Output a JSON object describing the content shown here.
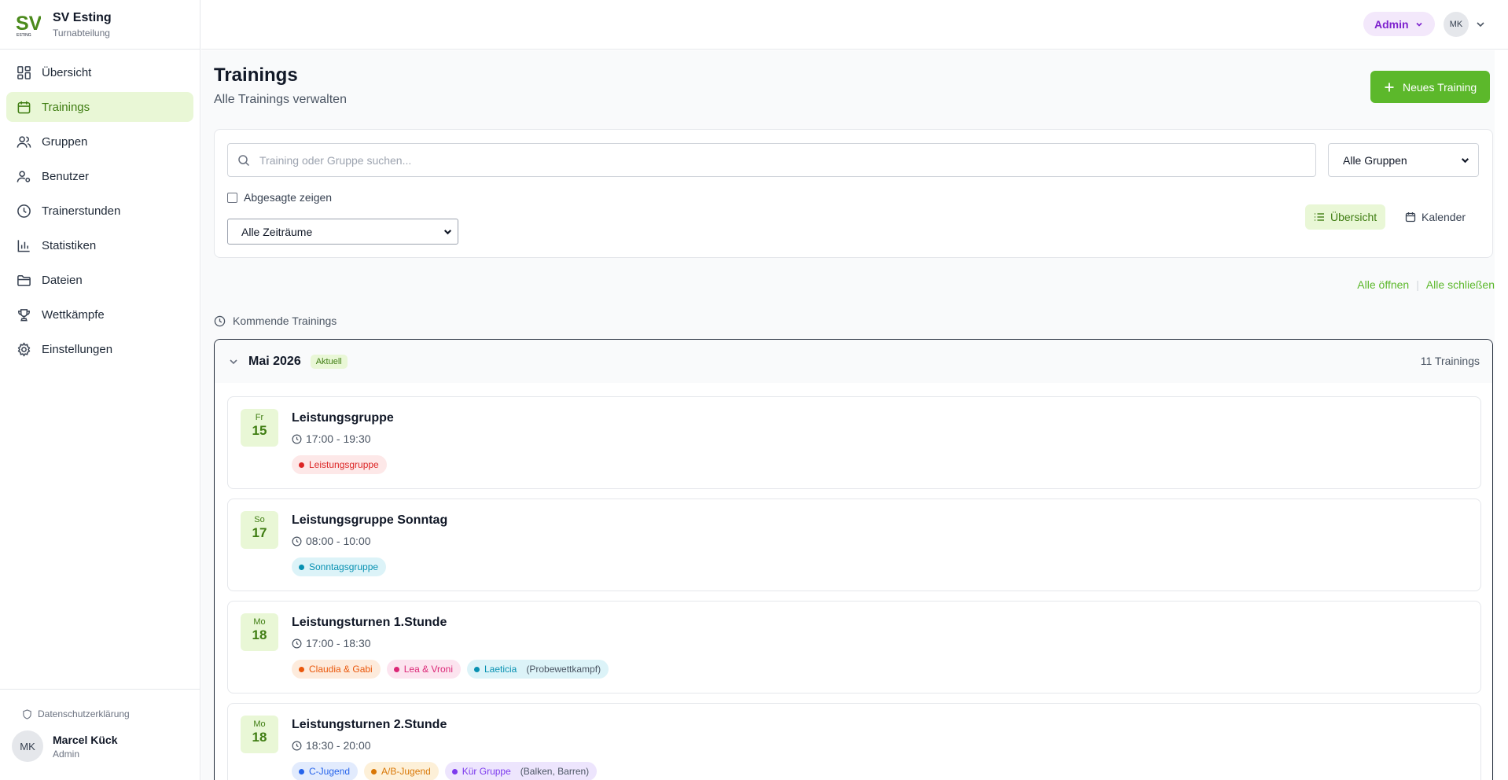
{
  "brand": {
    "logo_text": "SV",
    "logo_sub": "ESTING",
    "name": "SV Esting",
    "sub": "Turnabteilung"
  },
  "nav": [
    {
      "label": "Übersicht",
      "icon": "dashboard-icon"
    },
    {
      "label": "Trainings",
      "icon": "calendar-icon",
      "active": true
    },
    {
      "label": "Gruppen",
      "icon": "users-icon"
    },
    {
      "label": "Benutzer",
      "icon": "user-settings-icon"
    },
    {
      "label": "Trainerstunden",
      "icon": "clock-icon"
    },
    {
      "label": "Statistiken",
      "icon": "bar-chart-icon"
    },
    {
      "label": "Dateien",
      "icon": "folder-icon"
    },
    {
      "label": "Wettkämpfe",
      "icon": "trophy-icon"
    },
    {
      "label": "Einstellungen",
      "icon": "gear-icon"
    }
  ],
  "footer": {
    "privacy": "Datenschutzerklärung",
    "user_initials": "MK",
    "user_name": "Marcel Kück",
    "user_role": "Admin"
  },
  "topbar": {
    "role_label": "Admin",
    "avatar_initials": "MK"
  },
  "page": {
    "title": "Trainings",
    "subtitle": "Alle Trainings verwalten",
    "new_button": "Neues Training"
  },
  "filters": {
    "search_placeholder": "Training oder Gruppe suchen...",
    "group_select": "Alle Gruppen",
    "show_cancelled": "Abgesagte zeigen",
    "range_select": "Alle Zeiträume",
    "view_list": "Übersicht",
    "view_calendar": "Kalender"
  },
  "expand": {
    "open_all": "Alle öffnen",
    "close_all": "Alle schließen"
  },
  "upcoming_label": "Kommende Trainings",
  "month": {
    "name": "Mai 2026",
    "badge": "Aktuell",
    "count": "11 Trainings"
  },
  "trainings": [
    {
      "weekday": "Fr",
      "day": "15",
      "title": "Leistungsgruppe",
      "time": "17:00 - 19:30",
      "tags": [
        {
          "label": "Leistungsgruppe",
          "color": "#dc2626",
          "bg": "#fde8e8"
        }
      ]
    },
    {
      "weekday": "So",
      "day": "17",
      "title": "Leistungsgruppe Sonntag",
      "time": "08:00 - 10:00",
      "tags": [
        {
          "label": "Sonntagsgruppe",
          "color": "#0891b2",
          "bg": "#dcf3f8"
        }
      ]
    },
    {
      "weekday": "Mo",
      "day": "18",
      "title": "Leistungsturnen 1.Stunde",
      "time": "17:00 - 18:30",
      "tags": [
        {
          "label": "Claudia & Gabi",
          "color": "#ea580c",
          "bg": "#fdebdc"
        },
        {
          "label": "Lea & Vroni",
          "color": "#db2777",
          "bg": "#fce4ef"
        },
        {
          "label": "Laeticia",
          "note": "(Probewettkampf)",
          "color": "#0891b2",
          "bg": "#dcf3f8"
        }
      ]
    },
    {
      "weekday": "Mo",
      "day": "18",
      "title": "Leistungsturnen 2.Stunde",
      "time": "18:30 - 20:00",
      "tags": [
        {
          "label": "C-Jugend",
          "color": "#2563eb",
          "bg": "#e2ebfd"
        },
        {
          "label": "A/B-Jugend",
          "color": "#d97706",
          "bg": "#fdf0d8"
        },
        {
          "label": "Kür Gruppe",
          "note": "(Balken, Barren)",
          "color": "#7c3aed",
          "bg": "#ede5fd"
        }
      ]
    }
  ]
}
